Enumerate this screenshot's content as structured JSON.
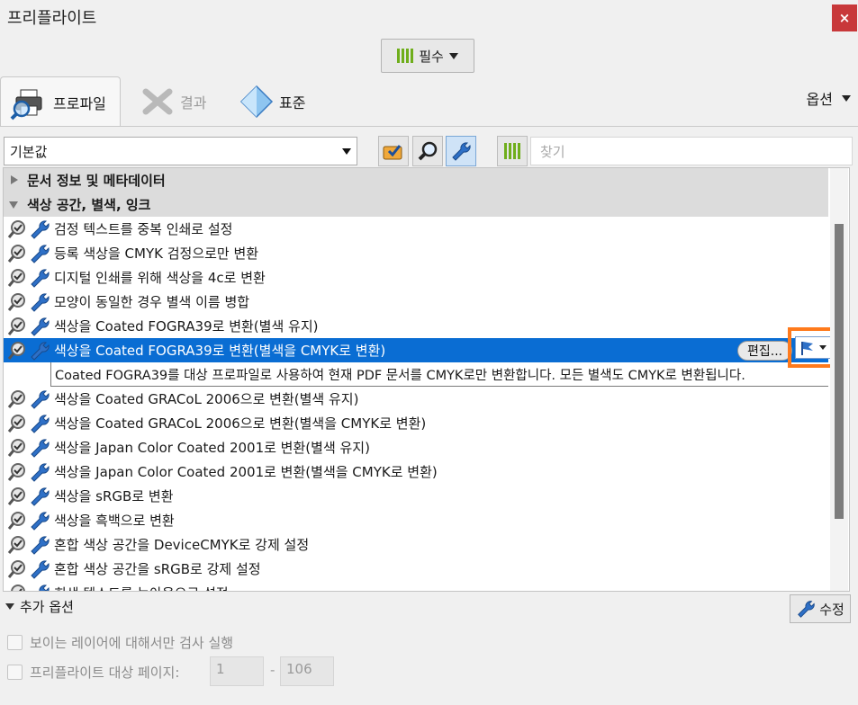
{
  "window": {
    "title": "프리플라이트",
    "close_label": "×"
  },
  "header": {
    "essentials_label": "필수"
  },
  "tabs": [
    {
      "label": "프로파일",
      "state": "active"
    },
    {
      "label": "결과",
      "state": "disabled"
    },
    {
      "label": "표준",
      "state": "normal"
    }
  ],
  "options_label": "옵션",
  "toolbar": {
    "profile_value": "기본값",
    "search_placeholder": "찾기"
  },
  "groups": [
    {
      "label": "문서 정보 및 메타데이터",
      "expanded": false
    },
    {
      "label": "색상 공간, 별색, 잉크",
      "expanded": true
    }
  ],
  "rows": [
    "검정 텍스트를 중복 인쇄로 설정",
    "등록 색상을 CMYK 검정으로만 변환",
    "디지털 인쇄를 위해 색상을 4c로 변환",
    "모양이 동일한 경우 별색 이름 병합",
    "색상을 Coated FOGRA39로 변환(별색 유지)",
    "색상을 Coated FOGRA39로 변환(별색을 CMYK로 변환)",
    "색상을 Coated GRACoL 2006으로 변환(별색 유지)",
    "색상을 Coated GRACoL 2006으로 변환(별색을 CMYK로 변환)",
    "색상을 Japan Color Coated 2001로 변환(별색 유지)",
    "색상을 Japan Color Coated 2001로 변환(별색을 CMYK로 변환)",
    "색상을 sRGB로 변환",
    "색상을 흑백으로 변환",
    "혼합 색상 공간을 DeviceCMYK로 강제 설정",
    "혼합 색상 공간을 sRGB로 강제 설정",
    "희색 텍스트를 녹아웃으로 설정"
  ],
  "selected": {
    "edit_label": "편집...",
    "description": "Coated FOGRA39를 대상 프로파일로 사용하여 현재 PDF 문서를 CMYK로만 변환합니다. 모든 별색도 CMYK로 변환됩니다."
  },
  "footer": {
    "more_options_label": "추가 옵션",
    "fix_label": "수정",
    "visible_layers_label": "보이는 레이어에 대해서만 검사 실행",
    "page_range_label": "프리플라이트 대상 페이지:",
    "page_from": "1",
    "page_to": "106"
  },
  "colors": {
    "selection": "#0a6dd3",
    "highlight": "#ff7a1c",
    "close": "#c8383a"
  }
}
